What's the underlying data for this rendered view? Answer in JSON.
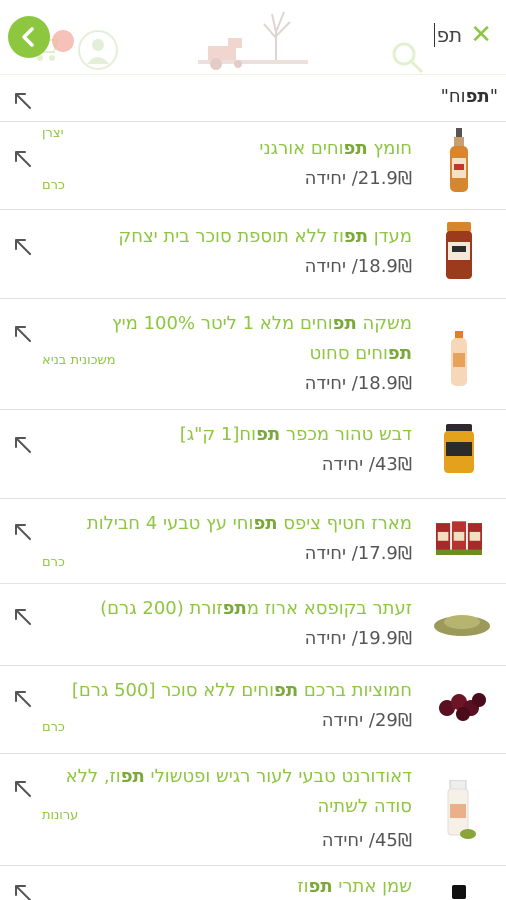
{
  "search": {
    "query": "תפ",
    "clear_icon": "close-icon",
    "back_icon": "chevron-left-icon"
  },
  "suggestion": {
    "prefix": "\"",
    "bold": "תפ",
    "rest": "וח",
    "suffix": "\""
  },
  "colors": {
    "accent": "#8dc63f",
    "divider": "#e2e2e2"
  },
  "results": [
    {
      "name_before": "חומץ ",
      "name_bold": "תפ",
      "name_after": "וחים אורגני",
      "price": "21.9₪/ יחידה",
      "brand": "יצרן",
      "brand2": "כרם"
    },
    {
      "name_before": "מעדן ",
      "name_bold": "תפ",
      "name_after": "וז ללא תוספת סוכר בית יצחק",
      "price": "18.9₪/ יחידה",
      "brand": ""
    },
    {
      "name_before": "משקה ",
      "name_bold": "תפ",
      "name_after": "וחים מלא 1 ליטר 100% מיץ",
      "name_line2_bold": "תפ",
      "name_line2_after": "וחים סחוט",
      "price": "18.9₪/ יחידה",
      "brand": "משכונית בניא"
    },
    {
      "name_before": "דבש טהור מכפר ",
      "name_bold": "תפ",
      "name_after": "וח[1 ק\"ג]",
      "price": "43₪/ יחידה",
      "brand": ""
    },
    {
      "name_before": "מארז חטיף ציפס ",
      "name_bold": "תפ",
      "name_after": "וחי עץ טבעי 4 חבילות",
      "price": "17.9₪/ יחידה",
      "brand": "כרם"
    },
    {
      "name_before": "זעתר בקופסא ארוז מ",
      "name_bold": "תפ",
      "name_after": "זורת (200 גרם)",
      "price": "19.9₪/ יחידה",
      "brand": ""
    },
    {
      "name_before": "חמוציות ברכם ",
      "name_bold": "תפ",
      "name_after": "וחים ללא סוכר [500 גרם]",
      "price": "29₪/ יחידה",
      "brand": "כרם"
    },
    {
      "name_before": "דאודורנט טבעי לעור רגיש ופטשולי ",
      "name_bold": "תפ",
      "name_after": "וז, ללא",
      "name_line2_after": "סודה לשתיה",
      "price": "45₪/ יחידה",
      "brand": "ערונות"
    },
    {
      "name_before": "שמן אתרי ",
      "name_bold": "תפ",
      "name_after": "וז",
      "price": "",
      "brand": ""
    }
  ]
}
